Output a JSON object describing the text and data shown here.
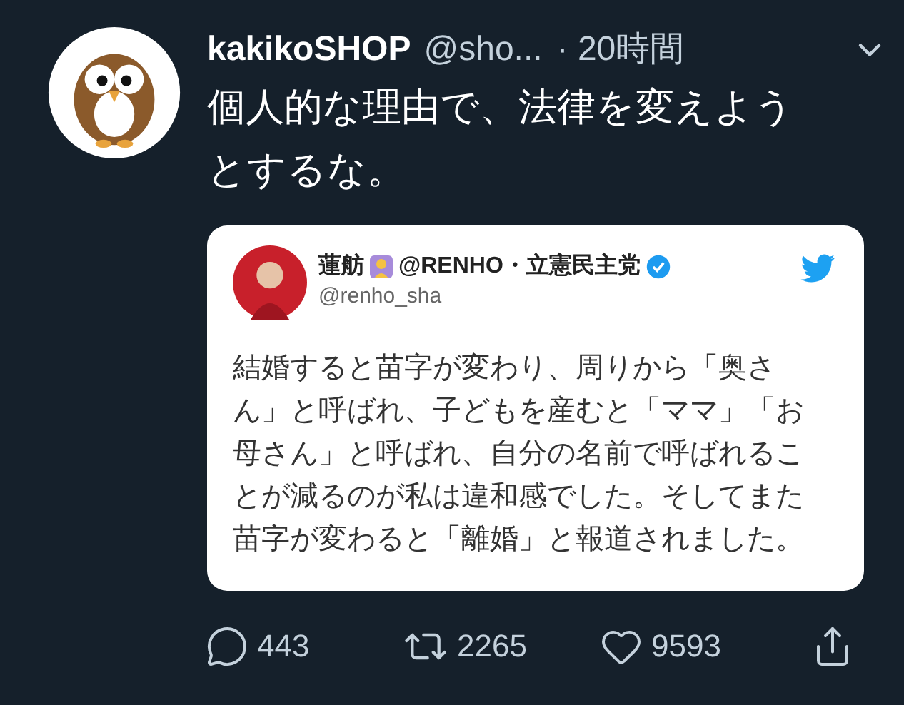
{
  "tweet": {
    "display_name": "kakikoSHOP",
    "handle": "@sho...",
    "time": "· 20時間",
    "text_lines": [
      "個人的な理由で、法律を変えよう",
      "とするな。"
    ],
    "quoted_image": {
      "display_name": "蓮舫",
      "display_suffix": "@RENHO・立憲民主党",
      "verified": true,
      "handle": "@renho_sha",
      "body_lines": [
        "結婚すると苗字が変わり、周りから「奥さ",
        "ん」と呼ばれ、子どもを産むと「ママ」「お",
        "母さん」と呼ばれ、自分の名前で呼ばれるこ",
        "とが減るのが私は違和感でした。そしてまた",
        "苗字が変わると「離婚」と報道されました。"
      ]
    },
    "actions": [
      {
        "kind": "reply",
        "count": "443"
      },
      {
        "kind": "retweet",
        "count": "2265"
      },
      {
        "kind": "like",
        "count": "9593"
      },
      {
        "kind": "share"
      }
    ]
  }
}
